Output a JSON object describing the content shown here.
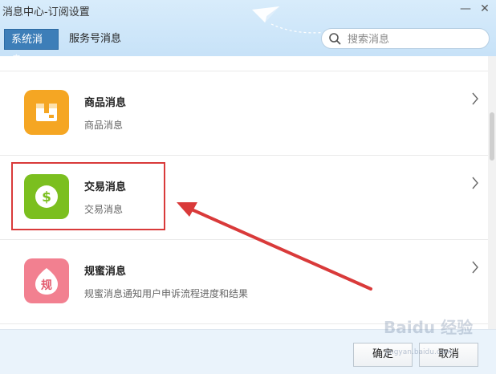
{
  "window": {
    "title": "消息中心-订阅设置",
    "min_symbol": "—",
    "close_symbol": "✕"
  },
  "tabs": [
    {
      "label": "系统消息",
      "active": true
    },
    {
      "label": "服务号消息",
      "active": false
    }
  ],
  "search": {
    "placeholder": "搜索消息",
    "value": ""
  },
  "items": [
    {
      "name": "商品消息",
      "desc": "商品消息",
      "icon": "package-icon",
      "color": "#f5a623"
    },
    {
      "name": "交易消息",
      "desc": "交易消息",
      "icon": "dollar-icon",
      "color": "#7bbf1f"
    },
    {
      "name": "规蜜消息",
      "desc": "规蜜消息通知用户申诉流程进度和结果",
      "icon": "rule-icon",
      "color": "#f28090",
      "icon_glyph": "规"
    }
  ],
  "footer": {
    "confirm": "确定",
    "cancel": "取消"
  },
  "watermark": {
    "brand": "Baidu 经验",
    "url": "jingyan.baidu.com"
  },
  "colors": {
    "accent": "#3d7eb8",
    "annotation": "#d93a3a"
  }
}
